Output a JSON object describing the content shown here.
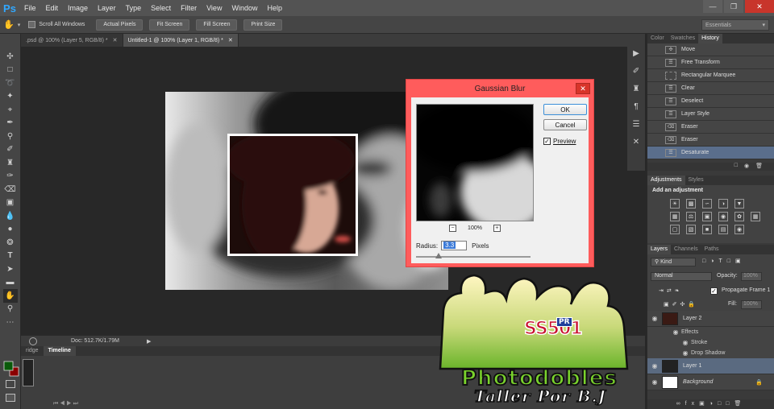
{
  "menubar": {
    "logo": "Ps",
    "items": [
      "File",
      "Edit",
      "Image",
      "Layer",
      "Type",
      "Select",
      "Filter",
      "View",
      "Window",
      "Help"
    ]
  },
  "options_bar": {
    "scroll_all_windows": "Scroll All Windows",
    "buttons": [
      "Actual Pixels",
      "Fit Screen",
      "Fill Screen",
      "Print Size"
    ],
    "workspace": "Essentials"
  },
  "doc_tabs": [
    {
      "label": ".psd @ 100% (Layer 5, RGB/8) *",
      "active": false
    },
    {
      "label": "Untitled-1 @ 100% (Layer 1, RGB/8) *",
      "active": true
    }
  ],
  "status": {
    "doc_size": "Doc: 512.7K/1.79M"
  },
  "bottom_tabs": [
    "ridge",
    "Timeline"
  ],
  "dialog": {
    "title": "Gaussian Blur",
    "ok_label": "OK",
    "cancel_label": "Cancel",
    "preview_label": "Preview",
    "preview_checked": true,
    "zoom": "100%",
    "radius_label": "Radius:",
    "radius_value": "3.3",
    "radius_unit": "Pixels"
  },
  "panels": {
    "top_tabs": [
      "Color",
      "Swatches",
      "History"
    ],
    "history": [
      {
        "label": "Move",
        "icon": "move-icon"
      },
      {
        "label": "Free Transform",
        "icon": "history-doc-icon"
      },
      {
        "label": "Rectangular Marquee",
        "icon": "marquee-icon"
      },
      {
        "label": "Clear",
        "icon": "history-doc-icon"
      },
      {
        "label": "Deselect",
        "icon": "history-doc-icon"
      },
      {
        "label": "Layer Style",
        "icon": "history-doc-icon"
      },
      {
        "label": "Eraser",
        "icon": "eraser-icon"
      },
      {
        "label": "Eraser",
        "icon": "eraser-icon"
      },
      {
        "label": "Desaturate",
        "icon": "history-doc-icon"
      }
    ],
    "adj_tabs": [
      "Adjustments",
      "Styles"
    ],
    "adj_title": "Add an adjustment",
    "layers_tabs": [
      "Layers",
      "Channels",
      "Paths"
    ],
    "kind_label": "Kind",
    "blend_mode": "Normal",
    "opacity_label": "Opacity:",
    "opacity_value": "100%",
    "propagate_label": "Propagate Frame 1",
    "fill_label": "Fill:",
    "fill_value": "100%",
    "layers": [
      {
        "name": "Layer 2"
      },
      {
        "sub": "Effects"
      },
      {
        "sub": "Stroke"
      },
      {
        "sub": "Drop Shadow"
      },
      {
        "name": "Layer 1"
      },
      {
        "name": "Background"
      }
    ]
  },
  "watermark": {
    "brand": "Photodobles",
    "sub": "Taller Por B.J",
    "badge": "SS501",
    "badge_small": "PR"
  }
}
